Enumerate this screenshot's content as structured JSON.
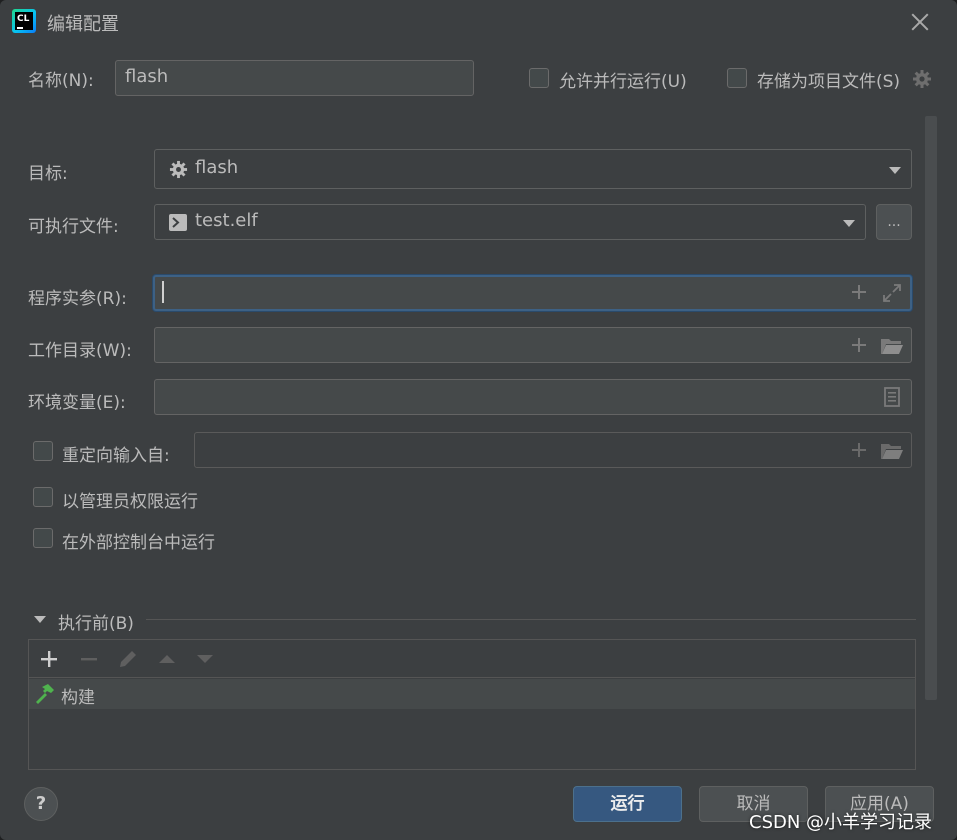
{
  "window": {
    "title": "编辑配置"
  },
  "form": {
    "name_label": "名称(N):",
    "name_value": "flash",
    "allow_parallel_label": "允许并行运行(U)",
    "store_as_project_file_label": "存储为项目文件(S)",
    "target_label": "目标:",
    "target_value": "flash",
    "executable_label": "可执行文件:",
    "executable_value": "test.elf",
    "executable_browse_label": "...",
    "program_args_label": "程序实参(R):",
    "program_args_value": "",
    "working_dir_label": "工作目录(W):",
    "working_dir_value": "",
    "env_vars_label": "环境变量(E):",
    "env_vars_value": "",
    "redirect_input_label": "重定向输入自:",
    "redirect_input_value": "",
    "run_as_admin_label": "以管理员权限运行",
    "run_in_console_label": "在外部控制台中运行"
  },
  "before_launch": {
    "section_label": "执行前(B)",
    "items": [
      {
        "label": "构建",
        "icon": "hammer-icon"
      }
    ]
  },
  "footer": {
    "help_label": "?",
    "run_label": "运行",
    "cancel_label": "取消",
    "apply_label": "应用(A)"
  },
  "watermark": "CSDN @小羊学习记录",
  "colors": {
    "background": "#3c3f41",
    "field": "#45494a",
    "primary_button": "#365880",
    "focus_border": "#3d6185",
    "hammer": "#4fb34e"
  }
}
